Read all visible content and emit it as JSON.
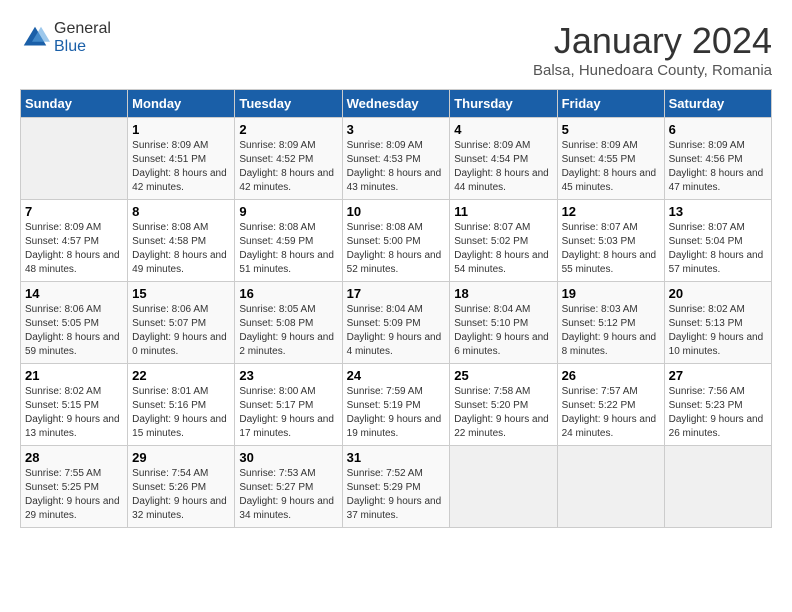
{
  "logo": {
    "general": "General",
    "blue": "Blue"
  },
  "header": {
    "title": "January 2024",
    "subtitle": "Balsa, Hunedoara County, Romania"
  },
  "days_of_week": [
    "Sunday",
    "Monday",
    "Tuesday",
    "Wednesday",
    "Thursday",
    "Friday",
    "Saturday"
  ],
  "weeks": [
    [
      {
        "day": "",
        "sunrise": "",
        "sunset": "",
        "daylight": ""
      },
      {
        "day": "1",
        "sunrise": "Sunrise: 8:09 AM",
        "sunset": "Sunset: 4:51 PM",
        "daylight": "Daylight: 8 hours and 42 minutes."
      },
      {
        "day": "2",
        "sunrise": "Sunrise: 8:09 AM",
        "sunset": "Sunset: 4:52 PM",
        "daylight": "Daylight: 8 hours and 42 minutes."
      },
      {
        "day": "3",
        "sunrise": "Sunrise: 8:09 AM",
        "sunset": "Sunset: 4:53 PM",
        "daylight": "Daylight: 8 hours and 43 minutes."
      },
      {
        "day": "4",
        "sunrise": "Sunrise: 8:09 AM",
        "sunset": "Sunset: 4:54 PM",
        "daylight": "Daylight: 8 hours and 44 minutes."
      },
      {
        "day": "5",
        "sunrise": "Sunrise: 8:09 AM",
        "sunset": "Sunset: 4:55 PM",
        "daylight": "Daylight: 8 hours and 45 minutes."
      },
      {
        "day": "6",
        "sunrise": "Sunrise: 8:09 AM",
        "sunset": "Sunset: 4:56 PM",
        "daylight": "Daylight: 8 hours and 47 minutes."
      }
    ],
    [
      {
        "day": "7",
        "sunrise": "Sunrise: 8:09 AM",
        "sunset": "Sunset: 4:57 PM",
        "daylight": "Daylight: 8 hours and 48 minutes."
      },
      {
        "day": "8",
        "sunrise": "Sunrise: 8:08 AM",
        "sunset": "Sunset: 4:58 PM",
        "daylight": "Daylight: 8 hours and 49 minutes."
      },
      {
        "day": "9",
        "sunrise": "Sunrise: 8:08 AM",
        "sunset": "Sunset: 4:59 PM",
        "daylight": "Daylight: 8 hours and 51 minutes."
      },
      {
        "day": "10",
        "sunrise": "Sunrise: 8:08 AM",
        "sunset": "Sunset: 5:00 PM",
        "daylight": "Daylight: 8 hours and 52 minutes."
      },
      {
        "day": "11",
        "sunrise": "Sunrise: 8:07 AM",
        "sunset": "Sunset: 5:02 PM",
        "daylight": "Daylight: 8 hours and 54 minutes."
      },
      {
        "day": "12",
        "sunrise": "Sunrise: 8:07 AM",
        "sunset": "Sunset: 5:03 PM",
        "daylight": "Daylight: 8 hours and 55 minutes."
      },
      {
        "day": "13",
        "sunrise": "Sunrise: 8:07 AM",
        "sunset": "Sunset: 5:04 PM",
        "daylight": "Daylight: 8 hours and 57 minutes."
      }
    ],
    [
      {
        "day": "14",
        "sunrise": "Sunrise: 8:06 AM",
        "sunset": "Sunset: 5:05 PM",
        "daylight": "Daylight: 8 hours and 59 minutes."
      },
      {
        "day": "15",
        "sunrise": "Sunrise: 8:06 AM",
        "sunset": "Sunset: 5:07 PM",
        "daylight": "Daylight: 9 hours and 0 minutes."
      },
      {
        "day": "16",
        "sunrise": "Sunrise: 8:05 AM",
        "sunset": "Sunset: 5:08 PM",
        "daylight": "Daylight: 9 hours and 2 minutes."
      },
      {
        "day": "17",
        "sunrise": "Sunrise: 8:04 AM",
        "sunset": "Sunset: 5:09 PM",
        "daylight": "Daylight: 9 hours and 4 minutes."
      },
      {
        "day": "18",
        "sunrise": "Sunrise: 8:04 AM",
        "sunset": "Sunset: 5:10 PM",
        "daylight": "Daylight: 9 hours and 6 minutes."
      },
      {
        "day": "19",
        "sunrise": "Sunrise: 8:03 AM",
        "sunset": "Sunset: 5:12 PM",
        "daylight": "Daylight: 9 hours and 8 minutes."
      },
      {
        "day": "20",
        "sunrise": "Sunrise: 8:02 AM",
        "sunset": "Sunset: 5:13 PM",
        "daylight": "Daylight: 9 hours and 10 minutes."
      }
    ],
    [
      {
        "day": "21",
        "sunrise": "Sunrise: 8:02 AM",
        "sunset": "Sunset: 5:15 PM",
        "daylight": "Daylight: 9 hours and 13 minutes."
      },
      {
        "day": "22",
        "sunrise": "Sunrise: 8:01 AM",
        "sunset": "Sunset: 5:16 PM",
        "daylight": "Daylight: 9 hours and 15 minutes."
      },
      {
        "day": "23",
        "sunrise": "Sunrise: 8:00 AM",
        "sunset": "Sunset: 5:17 PM",
        "daylight": "Daylight: 9 hours and 17 minutes."
      },
      {
        "day": "24",
        "sunrise": "Sunrise: 7:59 AM",
        "sunset": "Sunset: 5:19 PM",
        "daylight": "Daylight: 9 hours and 19 minutes."
      },
      {
        "day": "25",
        "sunrise": "Sunrise: 7:58 AM",
        "sunset": "Sunset: 5:20 PM",
        "daylight": "Daylight: 9 hours and 22 minutes."
      },
      {
        "day": "26",
        "sunrise": "Sunrise: 7:57 AM",
        "sunset": "Sunset: 5:22 PM",
        "daylight": "Daylight: 9 hours and 24 minutes."
      },
      {
        "day": "27",
        "sunrise": "Sunrise: 7:56 AM",
        "sunset": "Sunset: 5:23 PM",
        "daylight": "Daylight: 9 hours and 26 minutes."
      }
    ],
    [
      {
        "day": "28",
        "sunrise": "Sunrise: 7:55 AM",
        "sunset": "Sunset: 5:25 PM",
        "daylight": "Daylight: 9 hours and 29 minutes."
      },
      {
        "day": "29",
        "sunrise": "Sunrise: 7:54 AM",
        "sunset": "Sunset: 5:26 PM",
        "daylight": "Daylight: 9 hours and 32 minutes."
      },
      {
        "day": "30",
        "sunrise": "Sunrise: 7:53 AM",
        "sunset": "Sunset: 5:27 PM",
        "daylight": "Daylight: 9 hours and 34 minutes."
      },
      {
        "day": "31",
        "sunrise": "Sunrise: 7:52 AM",
        "sunset": "Sunset: 5:29 PM",
        "daylight": "Daylight: 9 hours and 37 minutes."
      },
      {
        "day": "",
        "sunrise": "",
        "sunset": "",
        "daylight": ""
      },
      {
        "day": "",
        "sunrise": "",
        "sunset": "",
        "daylight": ""
      },
      {
        "day": "",
        "sunrise": "",
        "sunset": "",
        "daylight": ""
      }
    ]
  ]
}
